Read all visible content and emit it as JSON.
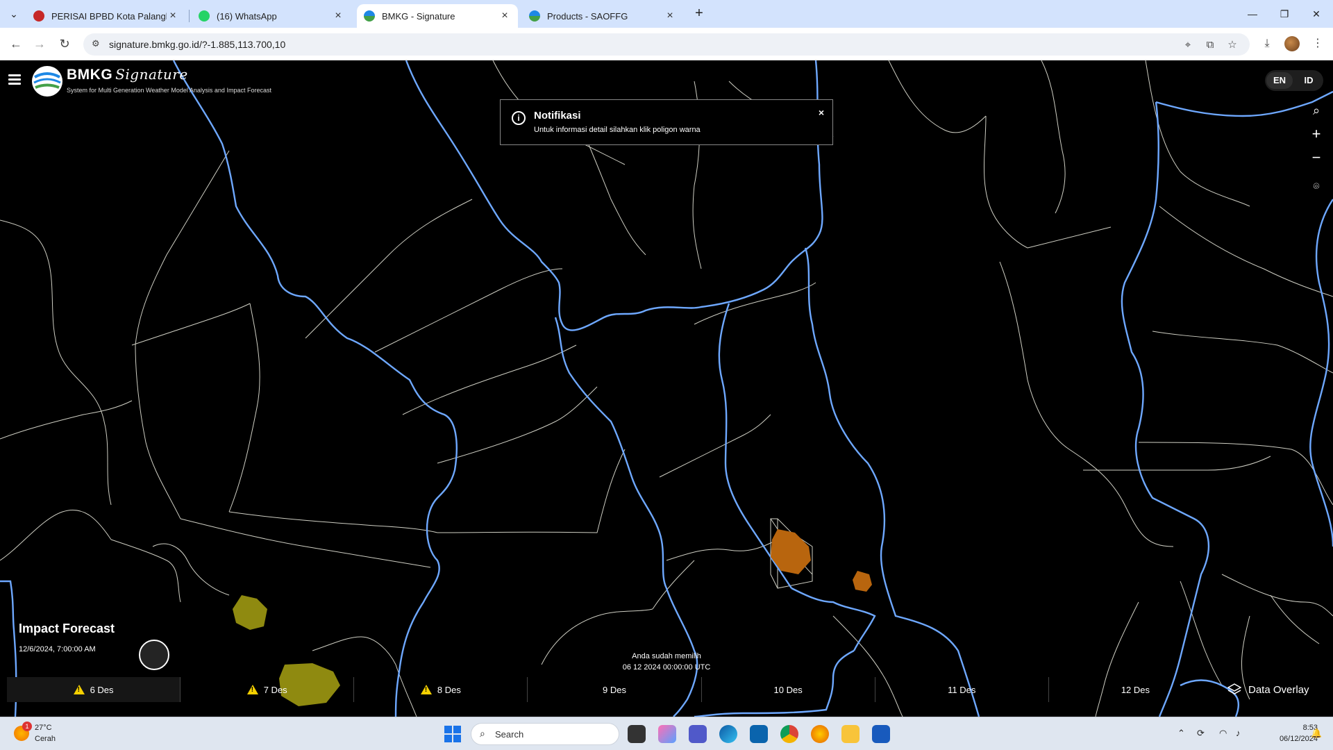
{
  "browser": {
    "tabs": [
      {
        "label": "PERISAI BPBD Kota Palangka Ra",
        "active": false
      },
      {
        "label": "(16) WhatsApp",
        "active": false
      },
      {
        "label": "BMKG - Signature",
        "active": true
      },
      {
        "label": "Products - SAOFFG",
        "active": false
      }
    ],
    "url": "signature.bmkg.go.id/?-1.885,113.700,10"
  },
  "app": {
    "brand": "BMKG",
    "brand_script": "Signature",
    "subtitle": "System for Multi Generation Weather Model Analysis and Impact Forecast",
    "lang_en": "EN",
    "lang_id": "ID",
    "notification": {
      "title": "Notifikasi",
      "body": "Untuk informasi detail silahkan klik poligon warna",
      "close": "×"
    },
    "impact_title": "Impact Forecast",
    "impact_date": "12/6/2024, 7:00:00 AM",
    "selected_line1": "Anda sudah memilih",
    "selected_line2": "06 12 2024 00:00:00 UTC",
    "days": [
      {
        "label": "6 Des",
        "warning": true,
        "selected": true
      },
      {
        "label": "7 Des",
        "warning": true,
        "selected": false
      },
      {
        "label": "8 Des",
        "warning": true,
        "selected": false
      },
      {
        "label": "9 Des",
        "warning": false,
        "selected": false
      },
      {
        "label": "10 Des",
        "warning": false,
        "selected": false
      },
      {
        "label": "11 Des",
        "warning": false,
        "selected": false
      },
      {
        "label": "12 Des",
        "warning": false,
        "selected": false
      }
    ],
    "data_overlay": "Data Overlay",
    "colors": {
      "boundary_major": "#6ea8ff",
      "boundary_minor": "#cfcfc4",
      "impact_yellow": "#8f8a10",
      "impact_orange": "#b8650e",
      "warning": "#f5d000"
    }
  },
  "taskbar": {
    "weather_temp": "27°C",
    "weather_cond": "Cerah",
    "weather_badge": "1",
    "search_placeholder": "Search",
    "time": "8:53",
    "date": "06/12/2024"
  }
}
